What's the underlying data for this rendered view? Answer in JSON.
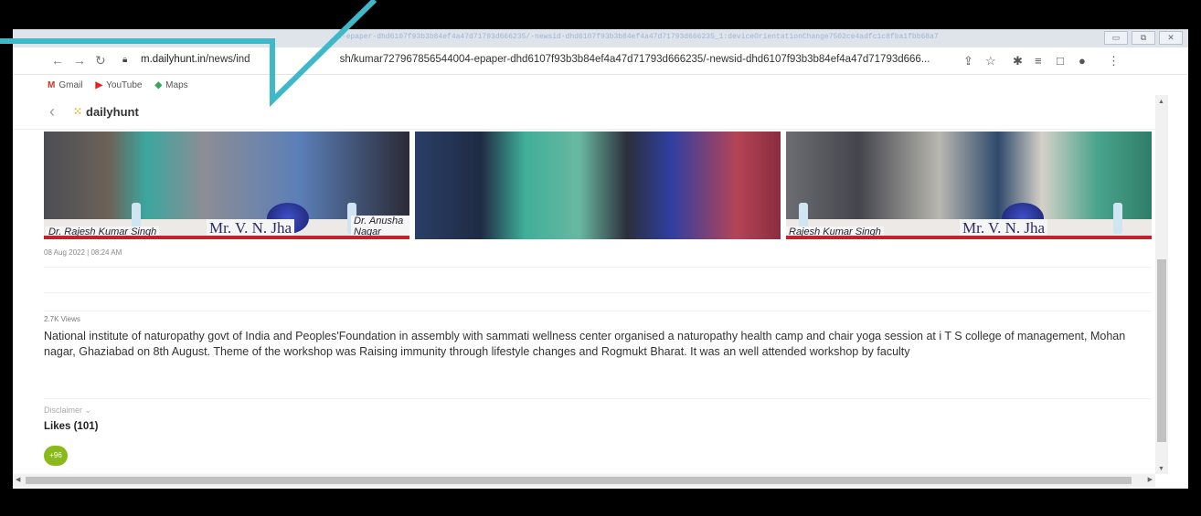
{
  "browser": {
    "tab_url_faded": "d-epaper-dhd6107f93b3b84ef4a47d71793d666235/-newsid-dhd6107f93b3b84ef4a47d71793d666235_1:deviceOrientationChange7502ce4adfc1c8fba1fbb68a7",
    "url_host": "m.dailyhunt.in",
    "url_path": "/news/ind",
    "url_rest": "sh/kumar727967856544004-epaper-dhd6107f93b3b84ef4a47d71793d666235/-newsid-dhd6107f93b3b84ef4a47d71793d666...",
    "bookmarks": [
      {
        "label": "Gmail",
        "icon": "gmail-icon",
        "color": "#d93025",
        "glyph": "M"
      },
      {
        "label": "YouTube",
        "icon": "youtube-icon",
        "color": "#e62117",
        "glyph": "▶"
      },
      {
        "label": "Maps",
        "icon": "maps-icon",
        "color": "#34a853",
        "glyph": "◆"
      }
    ]
  },
  "app": {
    "logo": "dailyhunt",
    "logo_dots": "⁙"
  },
  "photos": {
    "p1_name1": "Dr. Rajesh Kumar Singh",
    "p1_name2": "Mr. V. N. Jha",
    "p1_name3": "Dr. Anusha Nagar",
    "p3_name1": "Rajesh Kumar Singh",
    "p3_name2": "Mr. V. N. Jha"
  },
  "article": {
    "date": "08 Aug 2022  |  08:24 AM",
    "views": "2.7K Views",
    "body": "National institute of naturopathy govt of India and Peoples'Foundation in assembly with sammati wellness center organised a naturopathy health camp and chair yoga session at i T S college of management, Mohan nagar, Ghaziabad on 8th August. Theme of the workshop was Raising immunity through lifestyle changes and Rogmukt Bharat. It was an well attended workshop by faculty",
    "disclaimer": "Disclaimer ⌄",
    "likes": "Likes (101)",
    "like_button": "+96"
  },
  "colors": {
    "callout": "#3fb8c8",
    "like_green": "#8aba1a"
  }
}
